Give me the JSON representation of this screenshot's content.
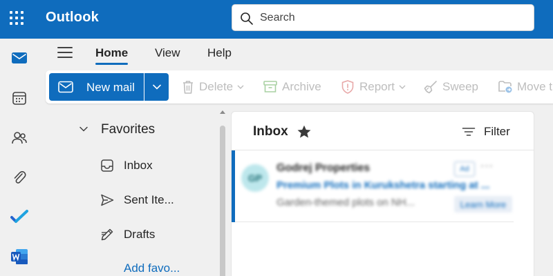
{
  "app": {
    "title": "Outlook"
  },
  "search": {
    "placeholder": "Search"
  },
  "colors": {
    "brand": "#0f6cbd",
    "background": "#f0f0f0",
    "disabled": "#bdbdbd"
  },
  "rail": {
    "items": [
      {
        "name": "mail-icon"
      },
      {
        "name": "calendar-icon"
      },
      {
        "name": "people-icon"
      },
      {
        "name": "attachment-icon"
      },
      {
        "name": "todo-icon"
      },
      {
        "name": "word-icon"
      }
    ]
  },
  "ribbon_tabs": {
    "home": "Home",
    "view": "View",
    "help": "Help"
  },
  "ribbon": {
    "new_mail": "New mail",
    "delete": "Delete",
    "archive": "Archive",
    "report": "Report",
    "sweep": "Sweep",
    "move_to": "Move t"
  },
  "folders": {
    "favorites_label": "Favorites",
    "inbox": "Inbox",
    "sent_items": "Sent Ite...",
    "drafts": "Drafts",
    "add_favorite": "Add favo..."
  },
  "mail_list": {
    "title": "Inbox",
    "filter_label": "Filter",
    "items": [
      {
        "avatar_initials": "GP",
        "sender": "Godrej Properties",
        "subject": "Premium Plots in Kurukshetra starting at ...",
        "preview": "Garden-themed plots on NH...",
        "badge": "Ad",
        "more": "···",
        "cta": "Learn More"
      }
    ]
  }
}
